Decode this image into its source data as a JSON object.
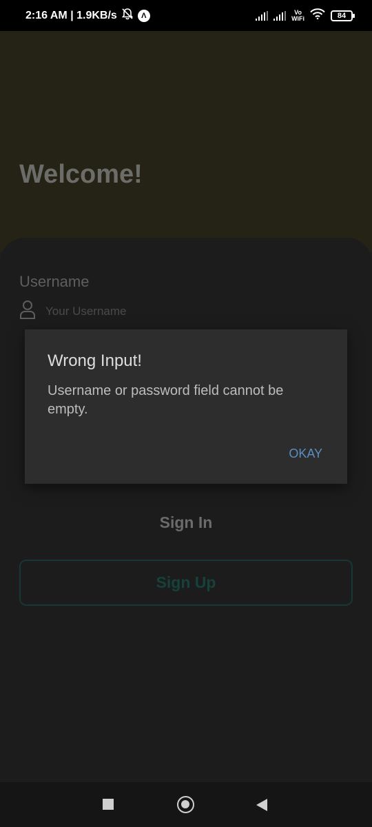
{
  "status_bar": {
    "time_speed": "2:16 AM | 1.9KB/s",
    "vowifi_top": "Vo",
    "vowifi_bottom": "WiFi",
    "battery": "84",
    "icons": [
      "mute-bell-icon",
      "app-notification-icon",
      "signal-icon",
      "signal-icon",
      "wifi-icon",
      "battery-icon"
    ]
  },
  "header": {
    "title": "Welcome!"
  },
  "form": {
    "username_label": "Username",
    "username_placeholder": "Your Username"
  },
  "buttons": {
    "sign_in": "Sign In",
    "sign_up": "Sign Up"
  },
  "dialog": {
    "title": "Wrong Input!",
    "message": "Username or password field cannot be empty.",
    "okay": "OKAY"
  },
  "colors": {
    "accent_teal": "#1b4a44",
    "dialog_action": "#5a8ec2",
    "header_bg": "#2a2818"
  }
}
